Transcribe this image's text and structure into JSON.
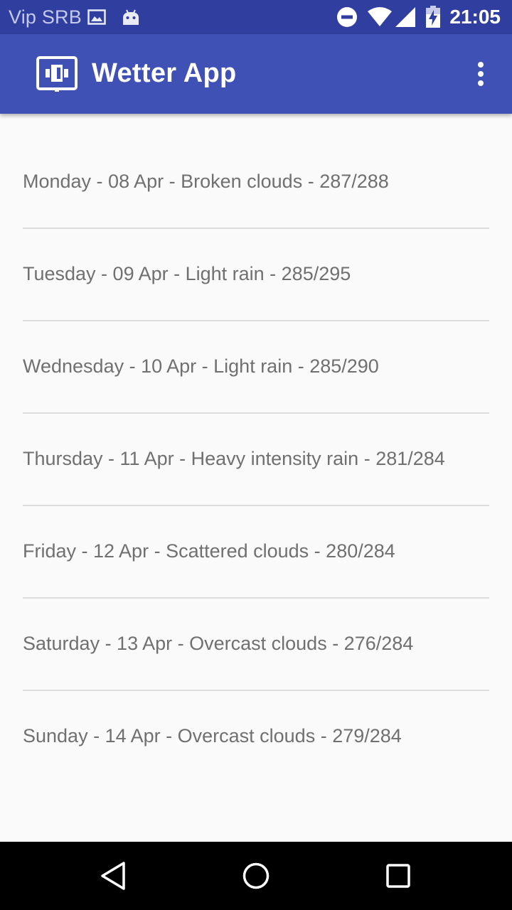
{
  "status_bar": {
    "carrier": "Vip SRB",
    "time": "21:05",
    "icons": [
      "image-icon",
      "android-icon",
      "do-not-disturb-icon",
      "wifi-icon",
      "signal-icon",
      "battery-charging-icon"
    ]
  },
  "app_bar": {
    "title": "Wetter App",
    "app_icon": "app-logo-icon",
    "overflow_icon": "more-vert-icon"
  },
  "forecast": [
    "Monday - 08 Apr - Broken clouds - 287/288",
    "Tuesday - 09 Apr - Light rain - 285/295",
    "Wednesday - 10 Apr - Light rain - 285/290",
    "Thursday - 11 Apr - Heavy intensity rain - 281/284",
    "Friday - 12 Apr - Scattered clouds - 280/284",
    "Saturday - 13 Apr - Overcast clouds - 276/284",
    "Sunday - 14 Apr - Overcast clouds - 279/284"
  ],
  "nav_bar": {
    "buttons": [
      "back-icon",
      "home-icon",
      "recents-icon"
    ]
  },
  "colors": {
    "status_bar": "#303f9f",
    "app_bar": "#3f51b5",
    "background": "#fafafa",
    "item_text": "#707070",
    "divider": "#dddddd",
    "nav_bar": "#000000"
  }
}
